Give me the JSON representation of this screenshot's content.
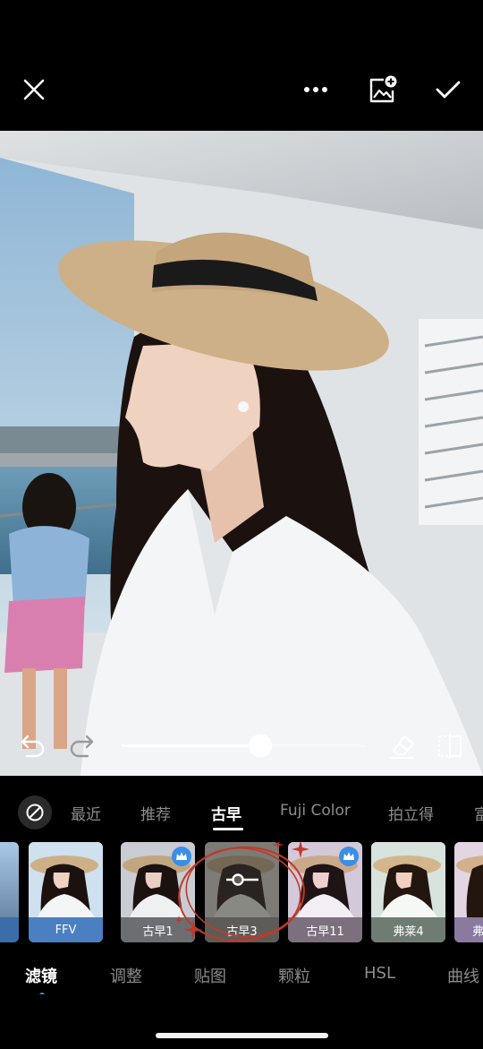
{
  "topbar": {
    "close_icon": "close-icon",
    "more_icon": "more-icon",
    "add_image_icon": "add-image-icon",
    "confirm_icon": "check-icon"
  },
  "editor": {
    "filter_strength": 0.57,
    "undo_icon": "undo-icon",
    "redo_icon": "redo-icon",
    "eraser_icon": "eraser-icon",
    "compare_icon": "compare-icon"
  },
  "categories": {
    "none_icon": "no-filter-icon",
    "items": [
      "最近",
      "推荐",
      "古早",
      "Fuji Color",
      "拍立得",
      "富"
    ],
    "active": "古早"
  },
  "filters": [
    {
      "label": "",
      "partial": true
    },
    {
      "label": "FFV",
      "premium": false
    },
    {
      "label": "古早1",
      "premium": true
    },
    {
      "label": "古早3",
      "premium": false,
      "selected": true
    },
    {
      "label": "古早11",
      "premium": true
    },
    {
      "label": "弗莱4",
      "premium": false
    },
    {
      "label": "弗",
      "partial": true
    }
  ],
  "tabs": {
    "items": [
      "滤镜",
      "调整",
      "贴图",
      "颗粒",
      "HSL",
      "曲线"
    ],
    "active": "滤镜"
  },
  "colors": {
    "accent": "#3a8ee6",
    "select_ring": "#c0392b",
    "background": "#000000"
  }
}
